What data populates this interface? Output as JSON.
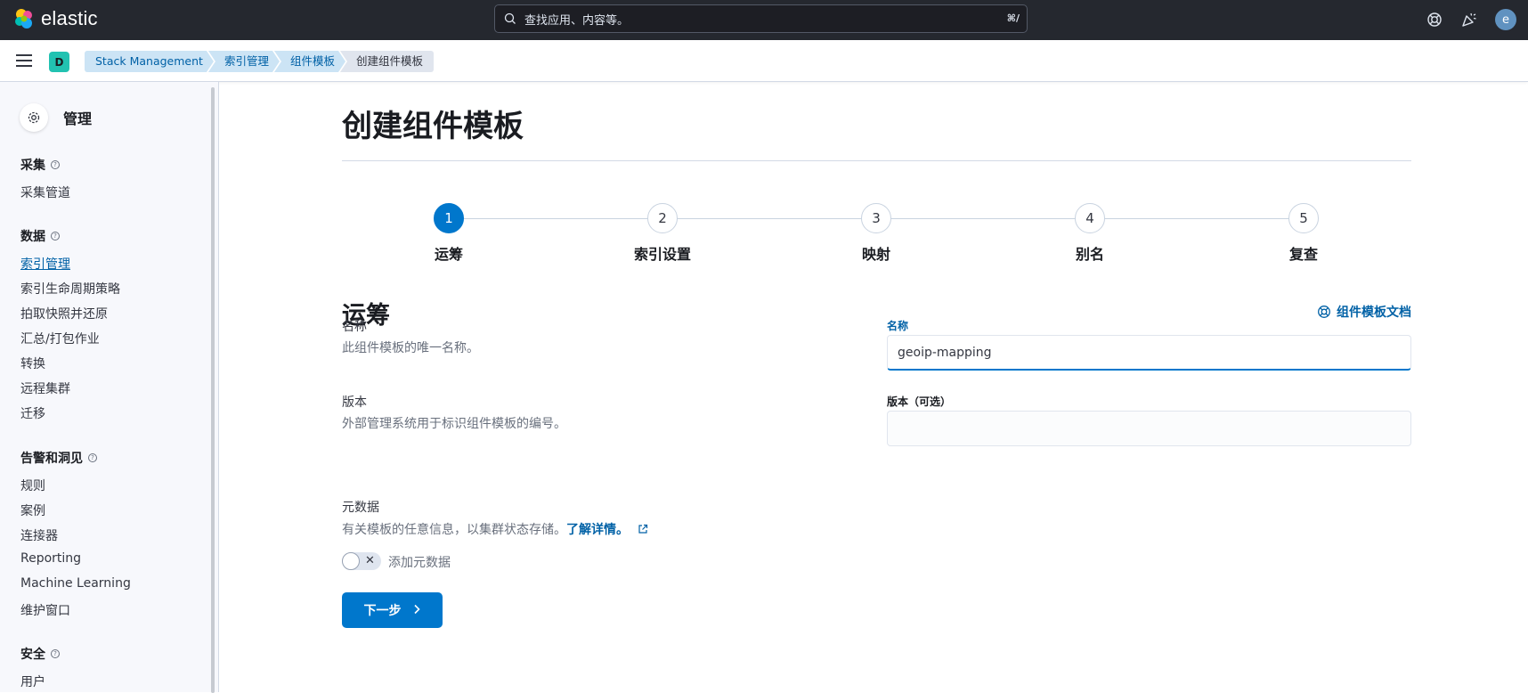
{
  "header": {
    "brand": "elastic",
    "search_placeholder": "查找应用、内容等。",
    "search_shortcut": "⌘/",
    "user_initial": "e"
  },
  "subbar": {
    "space_initial": "D",
    "breadcrumbs": [
      "Stack Management",
      "索引管理",
      "组件模板",
      "创建组件模板"
    ]
  },
  "sidebar": {
    "title": "管理",
    "groups": [
      {
        "label": "采集",
        "items": [
          "采集管道"
        ]
      },
      {
        "label": "数据",
        "items": [
          "索引管理",
          "索引生命周期策略",
          "拍取快照并还原",
          "汇总/打包作业",
          "转换",
          "远程集群",
          "迁移"
        ]
      },
      {
        "label": "告警和洞见",
        "items": [
          "规则",
          "案例",
          "连接器",
          "Reporting",
          "Machine Learning",
          "维护窗口"
        ]
      },
      {
        "label": "安全",
        "items": [
          "用户"
        ]
      }
    ],
    "active_item": "索引管理"
  },
  "main": {
    "title": "创建组件模板",
    "steps": [
      {
        "num": "1",
        "label": "运筹"
      },
      {
        "num": "2",
        "label": "索引设置"
      },
      {
        "num": "3",
        "label": "映射"
      },
      {
        "num": "4",
        "label": "别名"
      },
      {
        "num": "5",
        "label": "复查"
      }
    ],
    "current_step": 1,
    "section_title": "运筹",
    "docs_link": "组件模板文档",
    "name": {
      "label": "名称",
      "description": "此组件模板的唯一名称。",
      "field_label": "名称",
      "value": "geoip-mapping"
    },
    "version": {
      "label": "版本",
      "description": "外部管理系统用于标识组件模板的编号。",
      "field_label": "版本（可选）",
      "value": ""
    },
    "metadata": {
      "label": "元数据",
      "description": "有关模板的任意信息，以集群状态存储。",
      "learn_more": "了解详情。",
      "toggle_label": "添加元数据"
    },
    "next_button": "下一步"
  },
  "colors": {
    "primary": "#0077cc",
    "header_bg": "#25282f",
    "breadcrumb_bg": "#cce4f5",
    "space_badge": "#22c2b1"
  }
}
